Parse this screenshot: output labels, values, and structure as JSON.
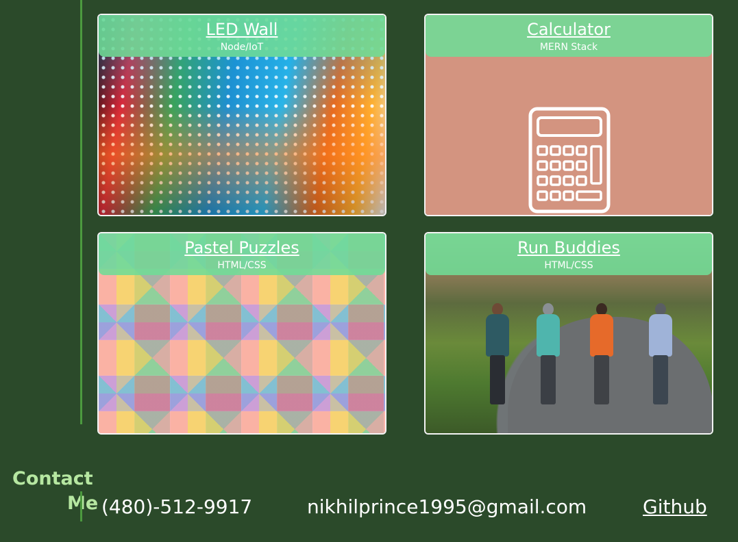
{
  "projects": [
    {
      "title": "LED Wall",
      "subtitle": "Node/IoT",
      "image_icon": "led-wall-photo"
    },
    {
      "title": "Calculator",
      "subtitle": "MERN Stack",
      "image_icon": "calculator-icon"
    },
    {
      "title": "Pastel Puzzles",
      "subtitle": "HTML/CSS",
      "image_icon": "puzzle-pattern"
    },
    {
      "title": "Run Buddies",
      "subtitle": "HTML/CSS",
      "image_icon": "runners-photo"
    }
  ],
  "contact": {
    "heading_line1": "Contact",
    "heading_line2": "Me",
    "phone": "(480)-512-9917",
    "email": "nikhilprince1995@gmail.com",
    "github": "Github"
  },
  "colors": {
    "background": "#2b4a2a",
    "accent_line": "#4c9a3f",
    "card_header": "#6fdc96",
    "contact_heading": "#b6e7a1",
    "calculator_bg": "#d39480"
  }
}
